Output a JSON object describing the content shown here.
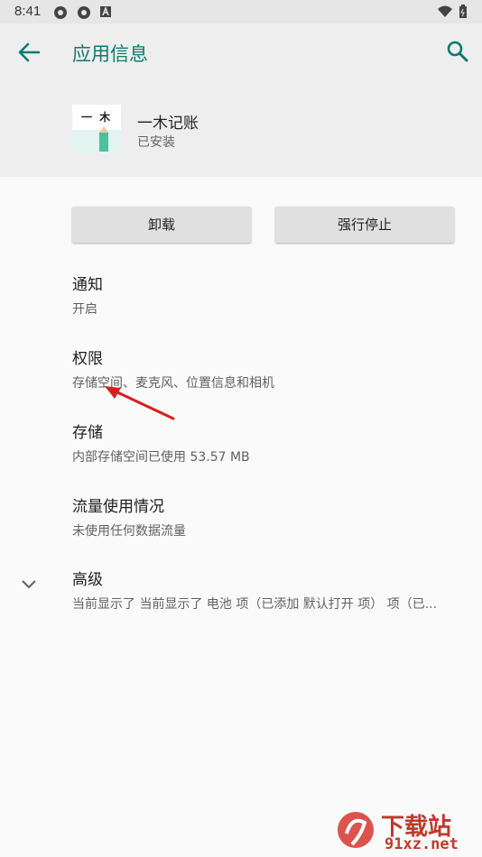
{
  "status_bar": {
    "time": "8:41"
  },
  "header": {
    "title": "应用信息",
    "app_icon_text": "一 木",
    "app_name": "一木记账",
    "app_status": "已安装"
  },
  "actions": {
    "uninstall": "卸载",
    "force_stop": "强行停止"
  },
  "settings": [
    {
      "title": "通知",
      "summary": "开启"
    },
    {
      "title": "权限",
      "summary": "存储空间、麦克风、位置信息和相机"
    },
    {
      "title": "存储",
      "summary": "内部存储空间已使用 53.57 MB"
    },
    {
      "title": "流量使用情况",
      "summary": "未使用任何数据流量"
    },
    {
      "title": "高级",
      "summary": "当前显示了 当前显示了 电池 项（已添加 默认打开 项） 项（已..."
    }
  ],
  "watermark": {
    "line1": "下载站",
    "line2": "91xz.net"
  },
  "colors": {
    "accent": "#0f7a6e",
    "annotation_arrow": "#d62020",
    "watermark": "#d8403a"
  }
}
